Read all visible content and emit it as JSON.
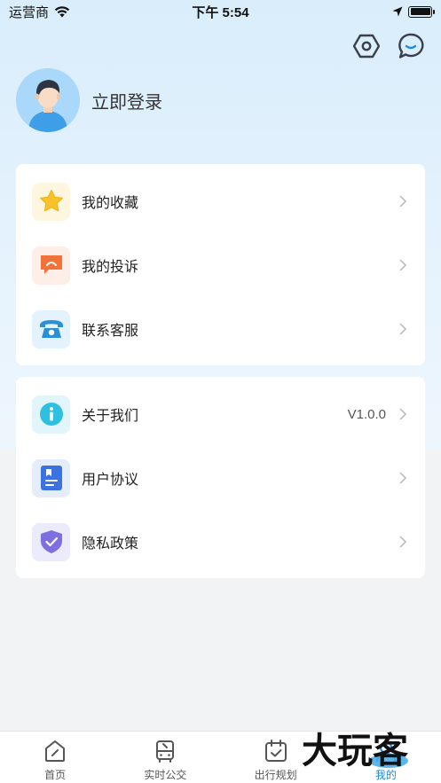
{
  "status_bar": {
    "carrier": "运营商",
    "time": "下午 5:54"
  },
  "profile": {
    "login_label": "立即登录"
  },
  "menu_group_1": [
    {
      "label": "我的收藏",
      "icon": "star-icon"
    },
    {
      "label": "我的投诉",
      "icon": "complaint-icon"
    },
    {
      "label": "联系客服",
      "icon": "phone-icon"
    }
  ],
  "menu_group_2": [
    {
      "label": "关于我们",
      "value": "V1.0.0",
      "icon": "info-icon"
    },
    {
      "label": "用户协议",
      "icon": "document-icon"
    },
    {
      "label": "隐私政策",
      "icon": "shield-icon"
    }
  ],
  "tabbar": [
    {
      "label": "首页",
      "icon": "home-icon"
    },
    {
      "label": "实时公交",
      "icon": "bus-icon"
    },
    {
      "label": "出行规划",
      "icon": "calendar-icon"
    },
    {
      "label": "我的",
      "icon": "user-icon",
      "active": true
    }
  ],
  "watermark": {
    "text": "大玩客"
  },
  "colors": {
    "accent": "#1e88e5",
    "header_bg": "#dcedfb",
    "page_bg": "#f2f3f5"
  }
}
